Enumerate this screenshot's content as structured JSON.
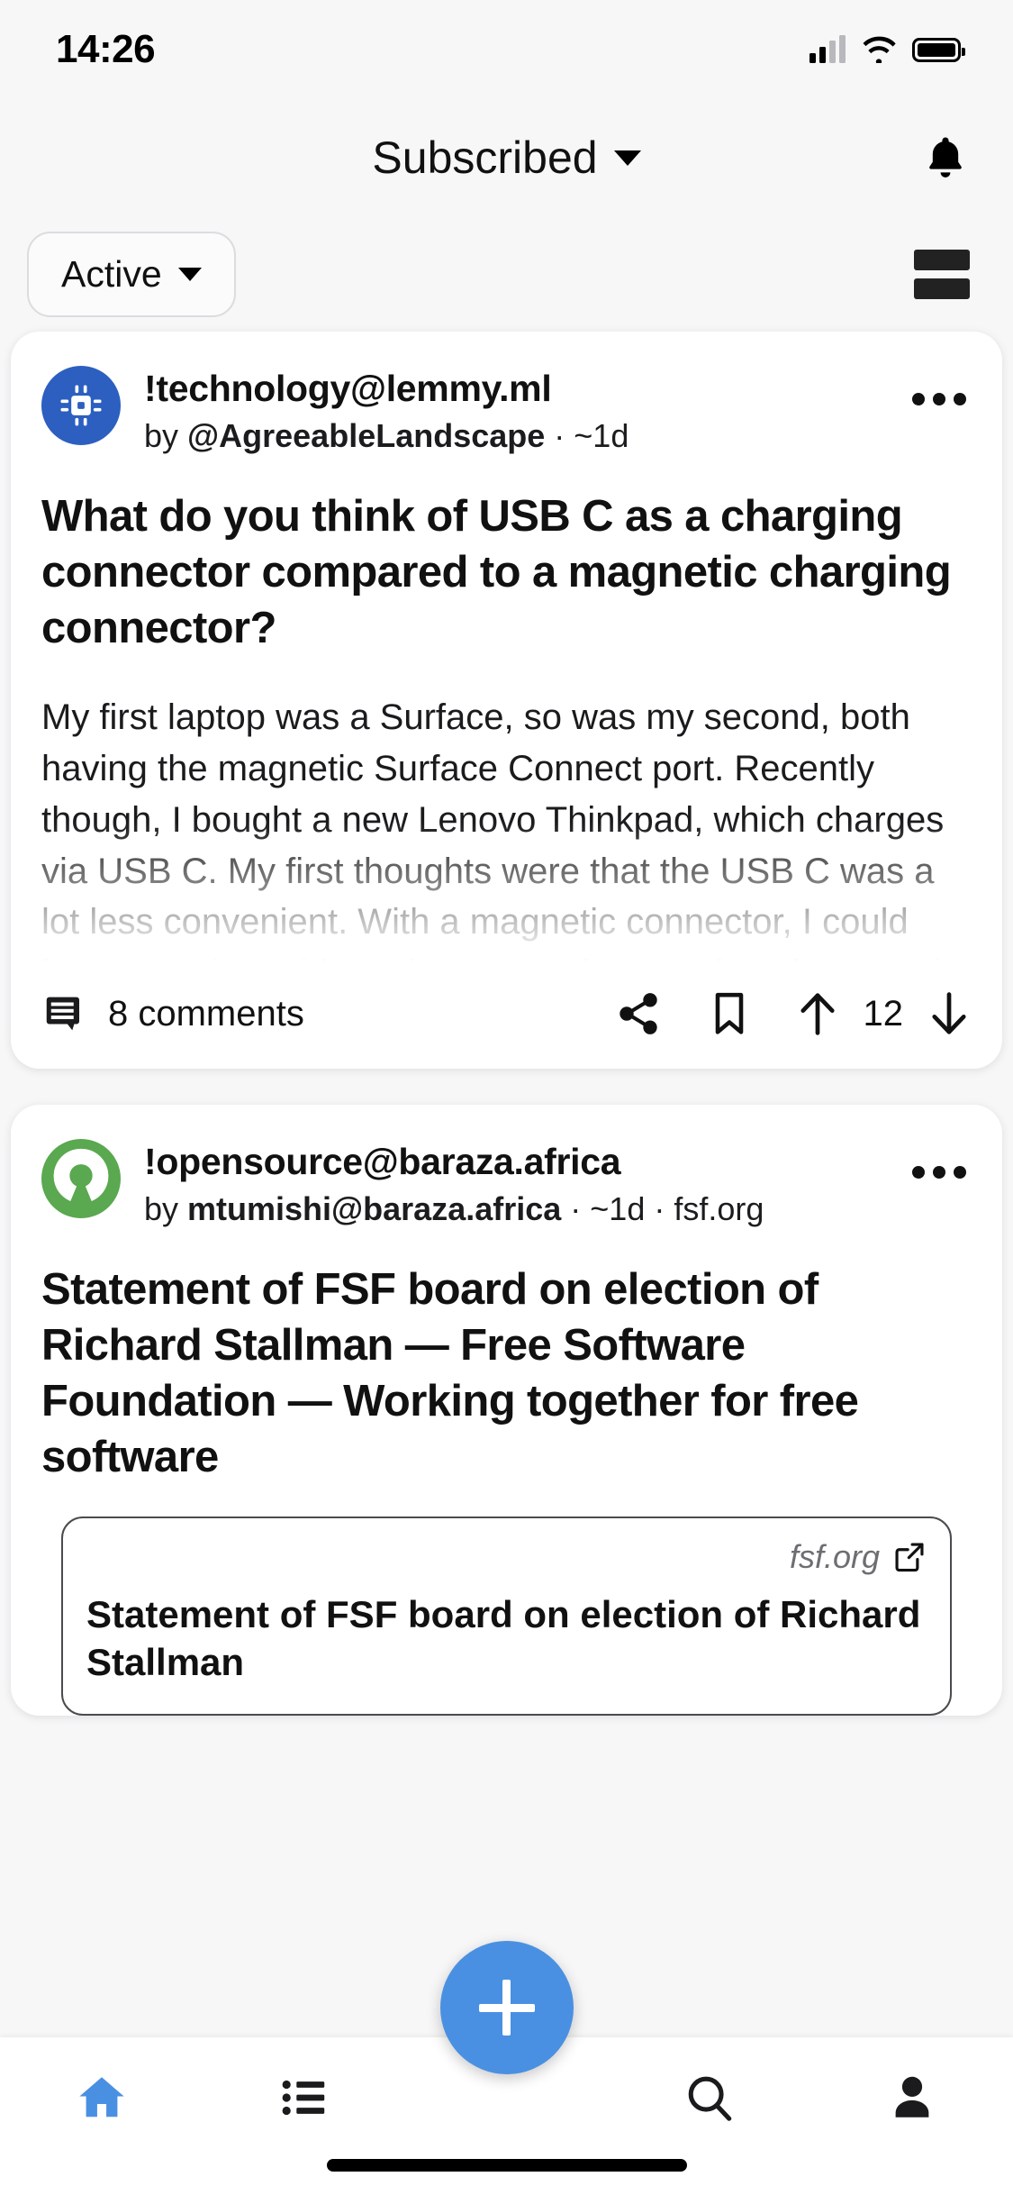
{
  "status_bar": {
    "time": "14:26",
    "signal_icon": "cellular-signal-icon",
    "wifi_icon": "wifi-icon",
    "battery_icon": "battery-icon"
  },
  "header": {
    "title": "Subscribed",
    "dropdown_icon": "chevron-down-icon",
    "notifications_icon": "bell-icon"
  },
  "filter_bar": {
    "sort_label": "Active",
    "sort_dropdown_icon": "chevron-down-icon",
    "view_mode_icon": "compact-view-icon"
  },
  "posts": [
    {
      "avatar_icon": "cpu-chip-icon",
      "avatar_color": "#2c5fc0",
      "community": "!technology@lemmy.ml",
      "byline_prefix": "by ",
      "author": "@AgreeableLandscape",
      "byline_suffix": " · ~1d",
      "more_icon": "more-options-icon",
      "title": "What do you think of USB C as a charging connector compared to a magnetic charging connector?",
      "body": "My first laptop was a Surface, so was my second, both having the magnetic Surface Connect port. Recently though, I bought a new Lenovo Thinkpad, which charges via USB C. My first thoughts were that the USB C was a lot less convenient. With a magnetic connector, I could just wave the cable at the port and more often than not, it would connect without me even having to look at it, whereas with the USB C port",
      "comments_label": "8 comments",
      "comments_icon": "comment-icon",
      "share_icon": "share-icon",
      "save_icon": "bookmark-icon",
      "upvote_icon": "arrow-up-icon",
      "score": "12",
      "downvote_icon": "arrow-down-icon"
    },
    {
      "avatar_icon": "open-source-icon",
      "avatar_color": "#5aa84f",
      "community": "!opensource@baraza.africa",
      "byline_prefix": "by ",
      "author": "mtumishi@baraza.africa",
      "byline_suffix": " · ~1d · fsf.org",
      "more_icon": "more-options-icon",
      "title": "Statement of FSF board on election of Richard Stallman — Free Software Foundation — Working together for free software",
      "link_preview": {
        "domain": "fsf.org",
        "external_icon": "external-link-icon",
        "title": "Statement of FSF board on election of Richard Stallman"
      }
    }
  ],
  "bottom_nav": {
    "items": [
      {
        "name": "home",
        "icon": "home-icon",
        "active": true
      },
      {
        "name": "communities",
        "icon": "list-icon",
        "active": false
      },
      {
        "name": "search",
        "icon": "search-icon",
        "active": false
      },
      {
        "name": "profile",
        "icon": "person-icon",
        "active": false
      }
    ],
    "create_post_icon": "plus-icon",
    "home_indicator": "home-indicator"
  },
  "colors": {
    "accent": "#4a90e2",
    "page_bg": "#f7f7f8",
    "card_bg": "#ffffff",
    "text": "#111111"
  }
}
